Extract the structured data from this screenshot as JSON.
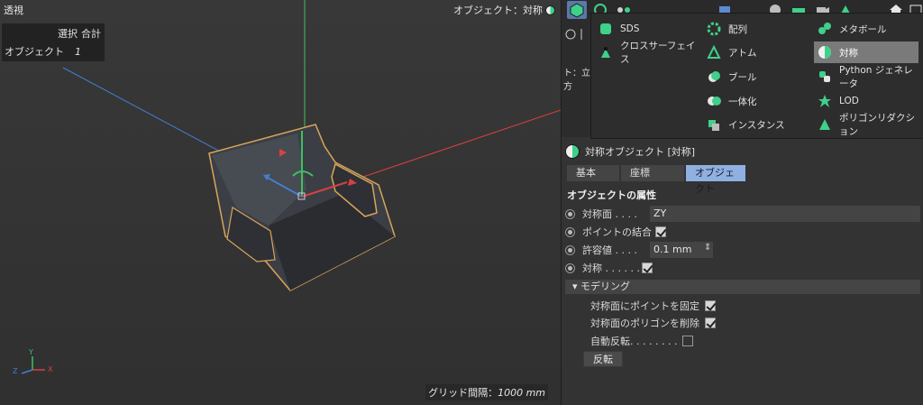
{
  "viewport": {
    "title": "透視",
    "hud": {
      "select_label": "選択",
      "total_label": "合計",
      "object_label": "オブジェクト",
      "object_count": "1"
    },
    "object_readout": "オブジェクト：対称",
    "grid_spacing_label": "グリッド間隔：",
    "grid_spacing_value": "1000 mm"
  },
  "left_strip": {
    "label": "ト：立方"
  },
  "generator_menu": {
    "columns": [
      [
        {
          "label": "SDS",
          "icon": "sds-icon"
        },
        {
          "label": "クロスサーフェイス",
          "icon": "cross-surface-icon"
        }
      ],
      [
        {
          "label": "配列",
          "icon": "array-icon"
        },
        {
          "label": "アトム",
          "icon": "atom-icon"
        },
        {
          "label": "ブール",
          "icon": "boole-icon"
        },
        {
          "label": "一体化",
          "icon": "connect-icon"
        },
        {
          "label": "インスタンス",
          "icon": "instance-icon"
        }
      ],
      [
        {
          "label": "メタボール",
          "icon": "metaball-icon"
        },
        {
          "label": "対称",
          "icon": "symmetry-icon",
          "selected": true
        },
        {
          "label": "Python ジェネレータ",
          "icon": "python-icon"
        },
        {
          "label": "LOD",
          "icon": "lod-icon"
        },
        {
          "label": "ポリゴンリダクション",
          "icon": "polygon-reduction-icon"
        }
      ]
    ]
  },
  "attributes": {
    "header": "対称オブジェクト [対称]",
    "tabs": [
      "基本",
      "座標",
      "オブジェクト"
    ],
    "active_tab": "オブジェクト",
    "section_title": "オブジェクトの属性",
    "mirror_plane_label": "対称面 . . . .",
    "mirror_plane_value": "ZY",
    "weld_points_label": "ポイントの結合",
    "tolerance_label": "許容値 . . . .",
    "tolerance_value": "0.1 mm",
    "symmetry_label": "対称 . . . . . .",
    "modeling_label": "▾ モデリング",
    "clamp_points_label": "対称面にポイントを固定",
    "delete_polygons_label": "対称面のポリゴンを削除",
    "auto_flip_label": "自動反転. . . . . . . .",
    "flip_button": "反転"
  },
  "colors": {
    "accent": "#8fb0e0",
    "icon_green": "#3fd08a",
    "selection_outline": "#d9a55b",
    "axis_x": "#d94040",
    "axis_y": "#40c060",
    "axis_z": "#4080d0"
  }
}
